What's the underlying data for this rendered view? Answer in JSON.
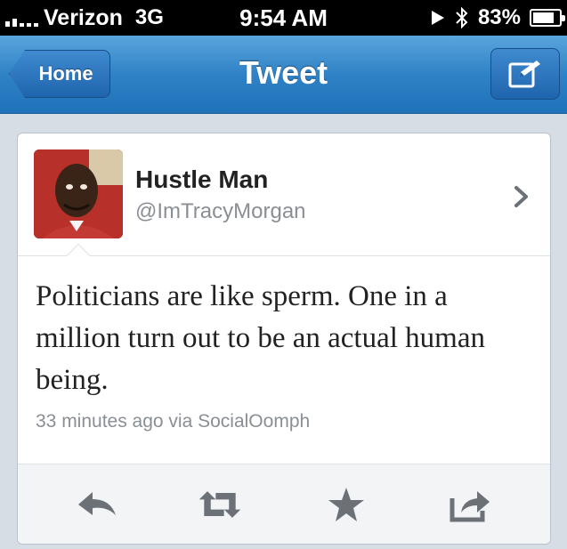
{
  "status_bar": {
    "carrier": "Verizon",
    "network": "3G",
    "time": "9:54 AM",
    "battery_percent": "83%",
    "battery_level": 0.83,
    "icons": [
      "signal-icon",
      "location-icon",
      "bluetooth-icon",
      "battery-icon"
    ]
  },
  "nav": {
    "back_label": "Home",
    "title": "Tweet",
    "compose_icon": "compose-icon"
  },
  "tweet": {
    "display_name": "Hustle Man",
    "handle": "@ImTracyMorgan",
    "text": "Politicians are like sperm. One in a million turn out to be an actual human being.",
    "timestamp": "33 minutes ago via SocialOomph"
  },
  "actions": {
    "icons": [
      "reply-icon",
      "retweet-icon",
      "favorite-icon",
      "share-icon"
    ]
  },
  "colors": {
    "nav_blue": "#2f82c6",
    "icon_gray": "#6b7177",
    "text_dark": "#222222",
    "text_gray": "#8a8f95"
  }
}
